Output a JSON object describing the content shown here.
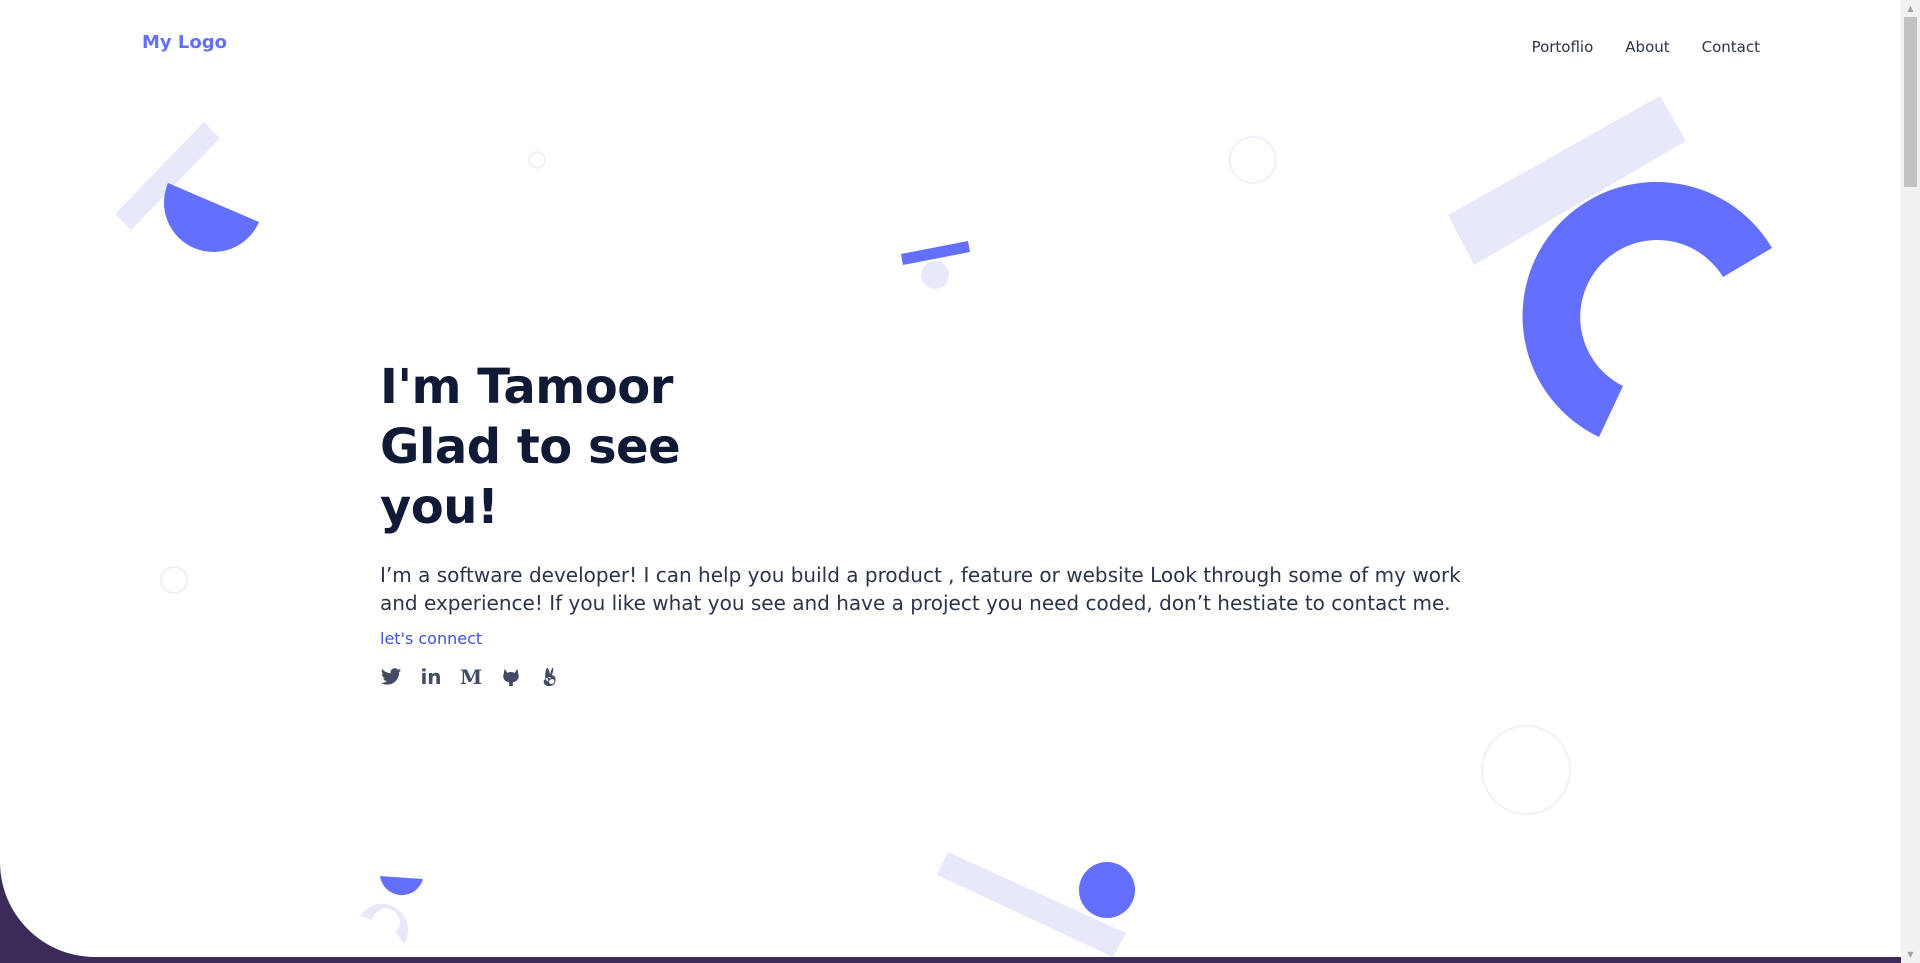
{
  "brand": {
    "logo_text": "My Logo",
    "accent_color": "#6370fe",
    "light_accent_color": "#e8e8fb",
    "heading_color": "#101935",
    "body_color": "#2c3447"
  },
  "nav": {
    "items": [
      {
        "label": "Portoflio"
      },
      {
        "label": "About"
      },
      {
        "label": "Contact"
      }
    ]
  },
  "hero": {
    "headline_lines": [
      "I'm Tamoor",
      "Glad to see",
      "you!"
    ],
    "bio": "I’m a software developer! I can help you build a product , feature or website Look through some of my work and experience! If you like what you see and have a project you need coded, don’t hestiate to contact me.",
    "connect_label": "let's connect"
  },
  "socials": [
    {
      "icon": "twitter-icon"
    },
    {
      "icon": "linkedin-icon",
      "glyph": "in"
    },
    {
      "icon": "medium-icon",
      "glyph": "M"
    },
    {
      "icon": "github-icon"
    },
    {
      "icon": "angellist-icon"
    }
  ]
}
